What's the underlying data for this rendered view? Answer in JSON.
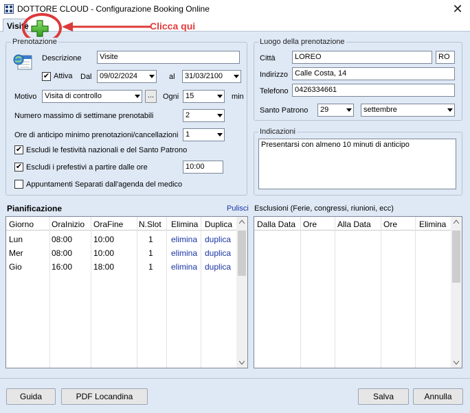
{
  "window": {
    "title": "DOTTORE CLOUD - Configurazione Booking Online",
    "close": "✕"
  },
  "tabs": [
    {
      "label": "Visite"
    }
  ],
  "annotation": {
    "callout": "Clicca qui"
  },
  "prenotazione": {
    "legend": "Prenotazione",
    "descrizione_label": "Descrizione",
    "descrizione_value": "Visite",
    "attiva_label": "Attiva",
    "attiva_checked": "✔",
    "dal_label": "Dal",
    "dal_value": "09/02/2024",
    "al_label": "al",
    "al_value": "31/03/2100",
    "motivo_label": "Motivo",
    "motivo_value": "Visita di controllo",
    "browse_label": "...",
    "ogni_label": "Ogni",
    "ogni_value": "15",
    "min_label": "min",
    "max_settimane_label": "Numero massimo di settimane prenotabili",
    "max_settimane_value": "2",
    "ore_anticipo_label": "Ore di anticipo minimo prenotazioni/cancellazioni",
    "ore_anticipo_value": "1",
    "escludi_festivita_label": "Escludi le festività nazionali e del Santo Patrono",
    "escludi_festivita_checked": "✔",
    "escludi_prefestivi_label": "Escludi i prefestivi a partire dalle ore",
    "escludi_prefestivi_checked": "✔",
    "prefestivi_ore_value": "10:00",
    "appuntamenti_separati_label": "Appuntamenti Separati dall'agenda del medico",
    "appuntamenti_separati_checked": ""
  },
  "luogo": {
    "legend": "Luogo della prenotazione",
    "citta_label": "Città",
    "citta_value": "LOREO",
    "provincia_value": "RO",
    "indirizzo_label": "Indirizzo",
    "indirizzo_value": "Calle Costa, 14",
    "telefono_label": "Telefono",
    "telefono_value": "0426334661",
    "santo_patrono_label": "Santo Patrono",
    "patrono_giorno": "29",
    "patrono_mese": "settembre"
  },
  "indicazioni": {
    "legend": "Indicazioni",
    "text": "Presentarsi con almeno 10 minuti di anticipo"
  },
  "pianificazione": {
    "title": "Pianificazione",
    "pulisci": "Pulisci",
    "columns": [
      "Giorno",
      "OraInizio",
      "OraFine",
      "N.Slot",
      "Elimina",
      "Duplica"
    ],
    "rows": [
      {
        "giorno": "Lun",
        "inizio": "08:00",
        "fine": "10:00",
        "slot": "1",
        "elimina": "elimina",
        "duplica": "duplica"
      },
      {
        "giorno": "Mer",
        "inizio": "08:00",
        "fine": "10:00",
        "slot": "1",
        "elimina": "elimina",
        "duplica": "duplica"
      },
      {
        "giorno": "Gio",
        "inizio": "16:00",
        "fine": "18:00",
        "slot": "1",
        "elimina": "elimina",
        "duplica": "duplica"
      }
    ]
  },
  "esclusioni": {
    "title": "Esclusioni (Ferie, congressi, riunioni, ecc)",
    "columns": [
      "Dalla Data",
      "Ore",
      "Alla Data",
      "Ore",
      "Elimina"
    ]
  },
  "footer": {
    "guida": "Guida",
    "pdf": "PDF Locandina",
    "salva": "Salva",
    "annulla": "Annulla"
  },
  "colors": {
    "accent_red": "#e23b3b",
    "link_blue": "#1a35a5",
    "panel_bg": "#dfe9f5"
  }
}
